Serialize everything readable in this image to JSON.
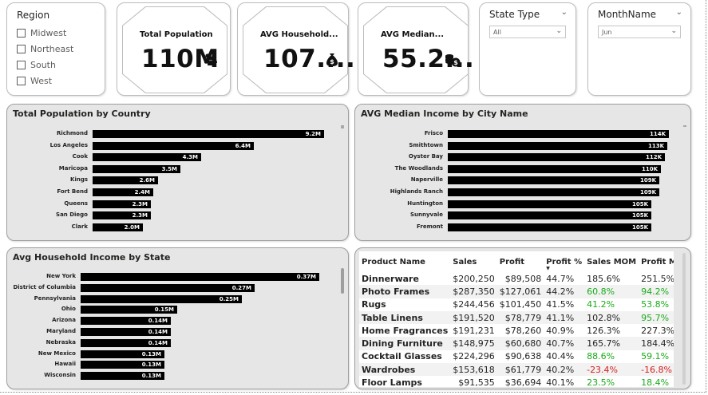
{
  "region_slicer": {
    "title": "Region",
    "items": [
      "Midwest",
      "Northeast",
      "South",
      "West"
    ]
  },
  "kpis": [
    {
      "label": "Total Population",
      "value": "110M",
      "icon": "people-icon"
    },
    {
      "label": "AVG Household...",
      "value": "107....",
      "icon": "money-bag-icon"
    },
    {
      "label": "AVG Median...",
      "value": "55.2...",
      "icon": "coins-money-icon"
    }
  ],
  "state_slicer": {
    "title": "State Type",
    "selected": "All"
  },
  "month_slicer": {
    "title": "MonthName",
    "selected": "Jun"
  },
  "population_chart": {
    "title": "Total Population by Country",
    "chart_data": {
      "type": "bar",
      "categories": [
        "Richmond",
        "Los Angeles",
        "Cook",
        "Maricopa",
        "Kings",
        "Fort Bend",
        "Queens",
        "San Diego",
        "Clark"
      ],
      "values": [
        9.2,
        6.4,
        4.3,
        3.5,
        2.6,
        2.4,
        2.3,
        2.3,
        2.0
      ],
      "labels": [
        "9.2M",
        "6.4M",
        "4.3M",
        "3.5M",
        "2.6M",
        "2.4M",
        "2.3M",
        "2.3M",
        "2.0M"
      ],
      "max": 9.2
    }
  },
  "median_chart": {
    "title": "AVG Median Income by City Name",
    "chart_data": {
      "type": "bar",
      "categories": [
        "Frisco",
        "Smithtown",
        "Oyster Bay",
        "The Woodlands",
        "Naperville",
        "Highlands Ranch",
        "Huntington",
        "Sunnyvale",
        "Fremont"
      ],
      "values": [
        114,
        113,
        112,
        110,
        109,
        109,
        105,
        105,
        105
      ],
      "labels": [
        "114K",
        "113K",
        "112K",
        "110K",
        "109K",
        "109K",
        "105K",
        "105K",
        "105K"
      ],
      "max": 114
    }
  },
  "household_chart": {
    "title": "Avg Household Income by State",
    "chart_data": {
      "type": "bar",
      "categories": [
        "New York",
        "District of Columbia",
        "Pennsylvania",
        "Ohio",
        "Arizona",
        "Maryland",
        "Nebraska",
        "New Mexico",
        "Hawaii",
        "Wisconsin"
      ],
      "values": [
        0.37,
        0.27,
        0.25,
        0.15,
        0.14,
        0.14,
        0.14,
        0.13,
        0.13,
        0.13
      ],
      "labels": [
        "0.37M",
        "0.27M",
        "0.25M",
        "0.15M",
        "0.14M",
        "0.14M",
        "0.14M",
        "0.13M",
        "0.13M",
        "0.13M"
      ],
      "max": 0.37
    }
  },
  "product_table": {
    "headers": [
      "Product Name",
      "Sales",
      "Profit",
      "Profit %",
      "Sales MOM",
      "Profit MOM"
    ],
    "rows": [
      [
        "Dinnerware",
        "$200,250",
        "$89,508",
        "44.7%",
        "185.6%",
        "251.5%"
      ],
      [
        "Photo Frames",
        "$287,350",
        "$127,061",
        "44.2%",
        "60.8%",
        "94.2%"
      ],
      [
        "Rugs",
        "$244,456",
        "$101,450",
        "41.5%",
        "41.2%",
        "53.8%"
      ],
      [
        "Table Linens",
        "$191,520",
        "$78,779",
        "41.1%",
        "102.8%",
        "95.7%"
      ],
      [
        "Home Fragrances",
        "$191,231",
        "$78,260",
        "40.9%",
        "126.3%",
        "227.3%"
      ],
      [
        "Dining Furniture",
        "$148,975",
        "$60,680",
        "40.7%",
        "165.7%",
        "184.4%"
      ],
      [
        "Cocktail Glasses",
        "$224,296",
        "$90,638",
        "40.4%",
        "88.6%",
        "59.1%"
      ],
      [
        "Wardrobes",
        "$153,618",
        "$61,779",
        "40.2%",
        "-23.4%",
        "-16.8%"
      ],
      [
        "Floor Lamps",
        "$91,535",
        "$36,694",
        "40.1%",
        "23.5%",
        "18.4%"
      ]
    ],
    "mom_colors": [
      [
        "#252423",
        "#252423"
      ],
      [
        "#1aab1a",
        "#1aab1a"
      ],
      [
        "#1aab1a",
        "#1aab1a"
      ],
      [
        "#252423",
        "#1aab1a"
      ],
      [
        "#252423",
        "#252423"
      ],
      [
        "#252423",
        "#252423"
      ],
      [
        "#1aab1a",
        "#1aab1a"
      ],
      [
        "#d42020",
        "#d42020"
      ],
      [
        "#1aab1a",
        "#1aab1a"
      ]
    ]
  }
}
